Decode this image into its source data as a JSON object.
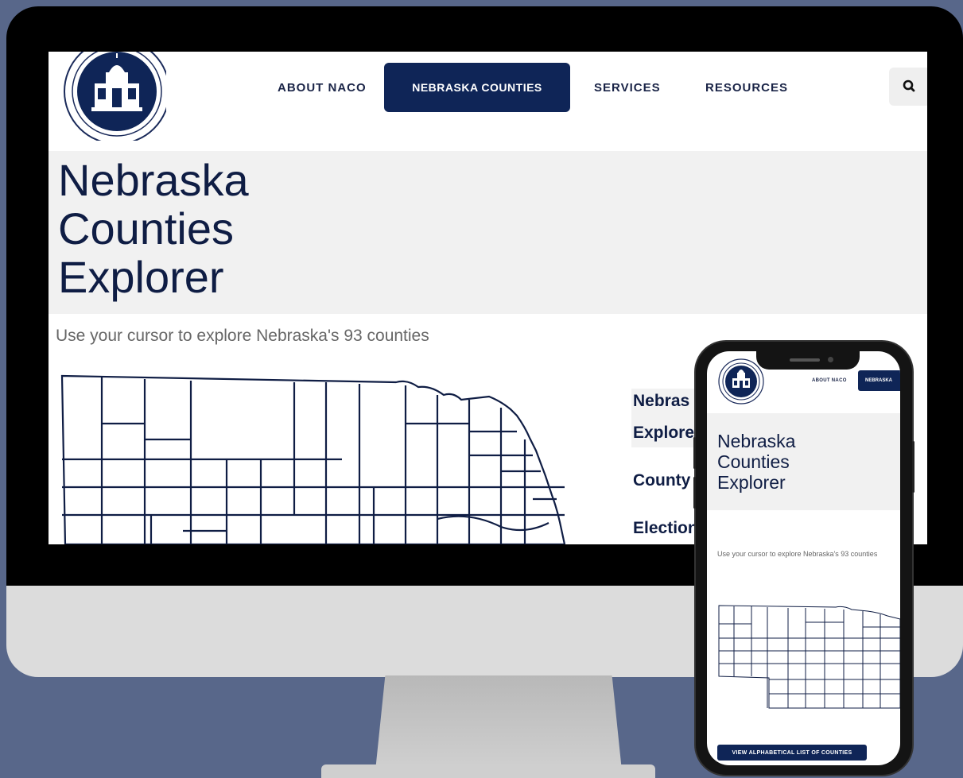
{
  "desktop": {
    "nav": {
      "items": [
        {
          "label": "ABOUT NACO"
        },
        {
          "label": "NEBRASKA COUNTIES",
          "active": true
        },
        {
          "label": "SERVICES"
        },
        {
          "label": "RESOURCES"
        }
      ],
      "search_icon": "search-icon"
    },
    "hero": {
      "title_lines": [
        "Nebraska",
        "Counties",
        "Explorer"
      ]
    },
    "subtitle": "Use your cursor to explore Nebraska's 93 counties",
    "sidebar_headings": [
      "Nebras",
      "Explore",
      "County",
      "Election"
    ]
  },
  "mobile": {
    "nav": {
      "about_label": "ABOUT NACO",
      "active_label": "NEBRASKA"
    },
    "hero": {
      "title_lines": [
        "Nebraska",
        "Counties",
        "Explorer"
      ]
    },
    "subtitle": "Use your cursor to explore Nebraska's 93 counties",
    "list_button": "VIEW ALPHABETICAL LIST OF COUNTIES"
  },
  "colors": {
    "background": "#58678a",
    "brand_navy": "#0f2557",
    "hero_gray": "#f1f1f1"
  }
}
